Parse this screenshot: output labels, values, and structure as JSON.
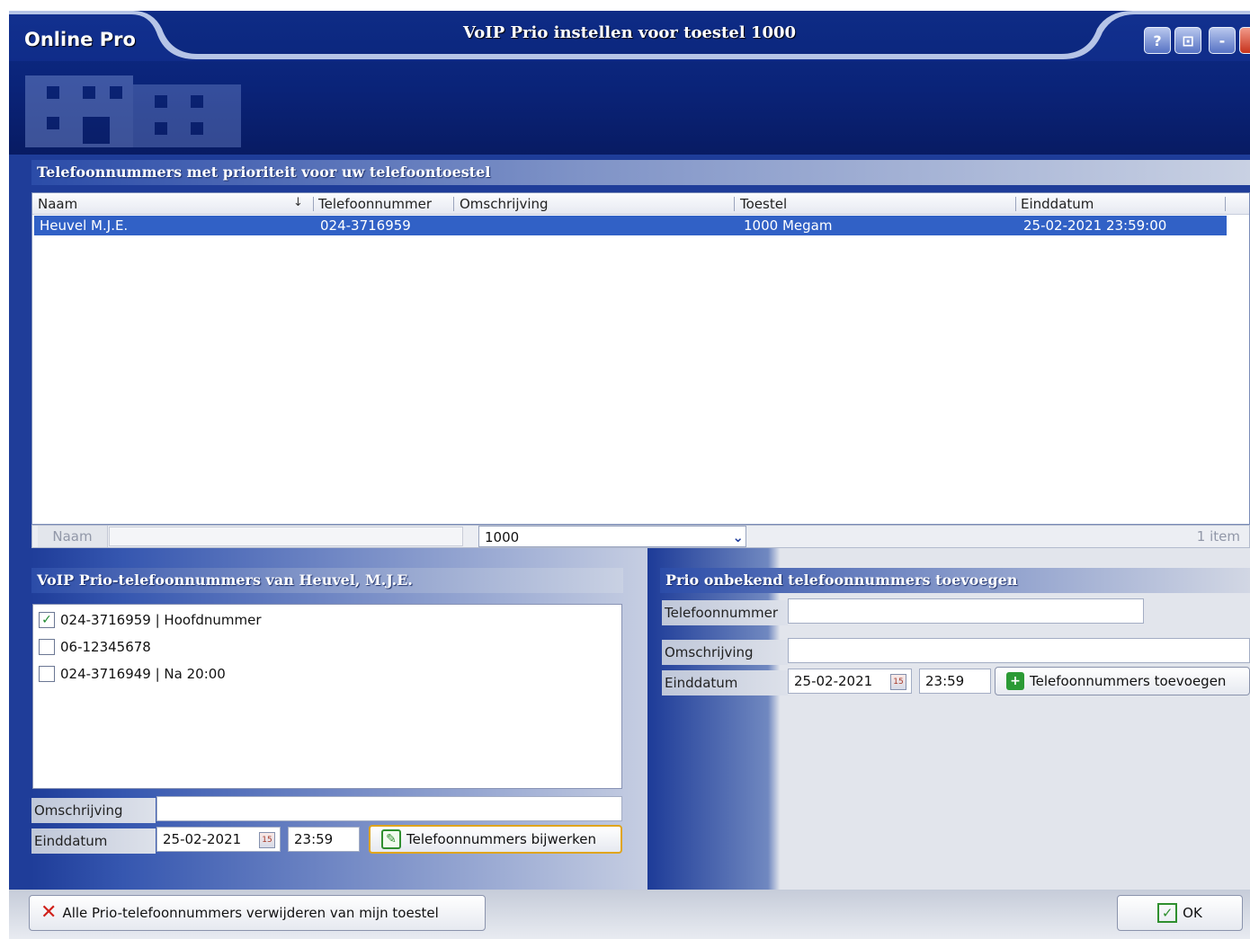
{
  "window": {
    "app_title": "Online Pro",
    "title": "VoIP Prio instellen voor toestel 1000",
    "buttons": {
      "help": "?",
      "settings": "⊡",
      "minimize": "-",
      "close": ""
    }
  },
  "priority_list": {
    "heading": "Telefoonnummers met prioriteit voor uw telefoontoestel",
    "columns": [
      "Naam",
      "Telefoonnummer",
      "Omschrijving",
      "Toestel",
      "Einddatum"
    ],
    "rows": [
      {
        "naam": "Heuvel M.J.E.",
        "telefoonnummer": "024-3716959",
        "omschrijving": "",
        "toestel": "1000 Megam",
        "einddatum": "25-02-2021 23:59:00"
      }
    ],
    "footer": {
      "naam_label": "Naam",
      "naam_value": "",
      "toestel_value": "1000",
      "count": "1 item"
    }
  },
  "contact_panel": {
    "heading": "VoIP Prio-telefoonnummers van Heuvel, M.J.E.",
    "numbers": [
      {
        "label": "024-3716959 | Hoofdnummer",
        "checked": true
      },
      {
        "label": "06-12345678",
        "checked": false
      },
      {
        "label": "024-3716949 | Na 20:00",
        "checked": false
      }
    ],
    "omschrijving_label": "Omschrijving",
    "omschrijving_value": "",
    "einddatum_label": "Einddatum",
    "date_value": "25-02-2021",
    "time_value": "23:59",
    "update_button": "Telefoonnummers bijwerken"
  },
  "unknown_panel": {
    "heading": "Prio onbekend telefoonnummers toevoegen",
    "telefoonnummer_label": "Telefoonnummer",
    "telefoonnummer_value": "",
    "omschrijving_label": "Omschrijving",
    "omschrijving_value": "",
    "einddatum_label": "Einddatum",
    "date_value": "25-02-2021",
    "time_value": "23:59",
    "add_button": "Telefoonnummers toevoegen"
  },
  "footer": {
    "remove_all_button": "Alle Prio-telefoonnummers verwijderen van mijn toestel",
    "ok_button": "OK"
  },
  "icons": {
    "check": "✓",
    "sort": "↓",
    "dropdown": "⌄",
    "calendar": "15",
    "edit": "✎",
    "add": "+",
    "remove": "✕",
    "ok": "✓"
  },
  "colors": {
    "selection": "#3161c6",
    "header": "#0a2378",
    "focus_border": "#e0a51c"
  }
}
